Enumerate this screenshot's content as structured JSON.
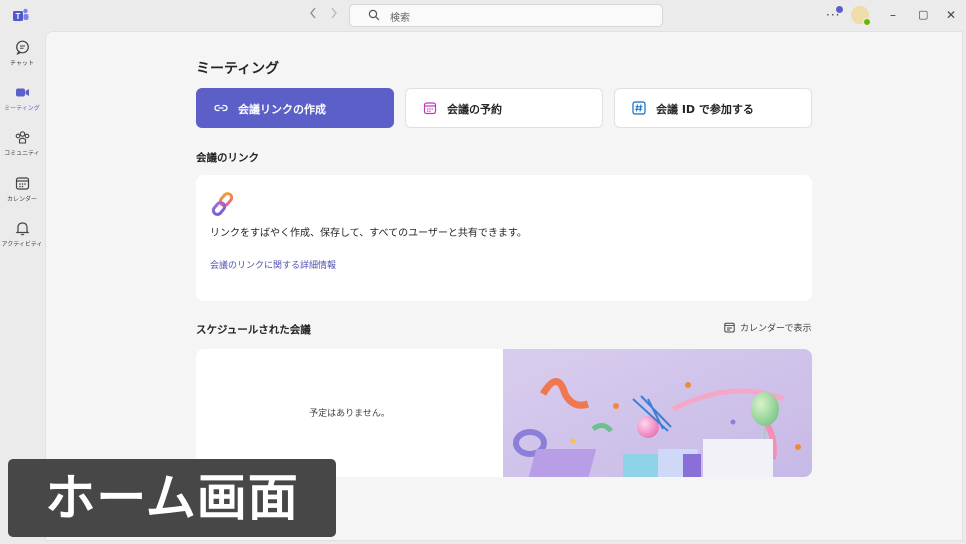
{
  "titlebar": {
    "search_placeholder": "検索",
    "back_icon": "chevron-left-icon",
    "forward_icon": "chevron-right-icon",
    "more_label": "···",
    "window_controls": {
      "minimize": "–",
      "maximize": "▢",
      "close": "✕"
    }
  },
  "rail": {
    "items": [
      {
        "label": "チャット",
        "icon": "chat-icon"
      },
      {
        "label": "ミーティング",
        "icon": "video-icon",
        "active": true
      },
      {
        "label": "コミュニティ",
        "icon": "people-icon"
      },
      {
        "label": "カレンダー",
        "icon": "calendar-icon"
      },
      {
        "label": "アクティビティ",
        "icon": "bell-icon"
      }
    ]
  },
  "main": {
    "title": "ミーティング",
    "actions": [
      {
        "label": "会議リンクの作成",
        "icon": "link-icon",
        "primary": true
      },
      {
        "label": "会議の予約",
        "icon": "calendar-icon"
      },
      {
        "label": "会議 ID で参加する",
        "icon": "hash-icon"
      }
    ],
    "link_section": {
      "title": "会議のリンク",
      "description": "リンクをすばやく作成、保存して、すべてのユーザーと共有できます。",
      "more_info": "会議のリンクに関する詳細情報"
    },
    "schedule_section": {
      "title": "スケジュールされた会議",
      "calendar_button": "カレンダーで表示",
      "empty_text": "予定はありません。"
    }
  },
  "overlay": {
    "caption": "ホーム画面"
  },
  "colors": {
    "accent": "#5b5fc7",
    "link": "#4f52b2",
    "presence": "#6bb700"
  }
}
